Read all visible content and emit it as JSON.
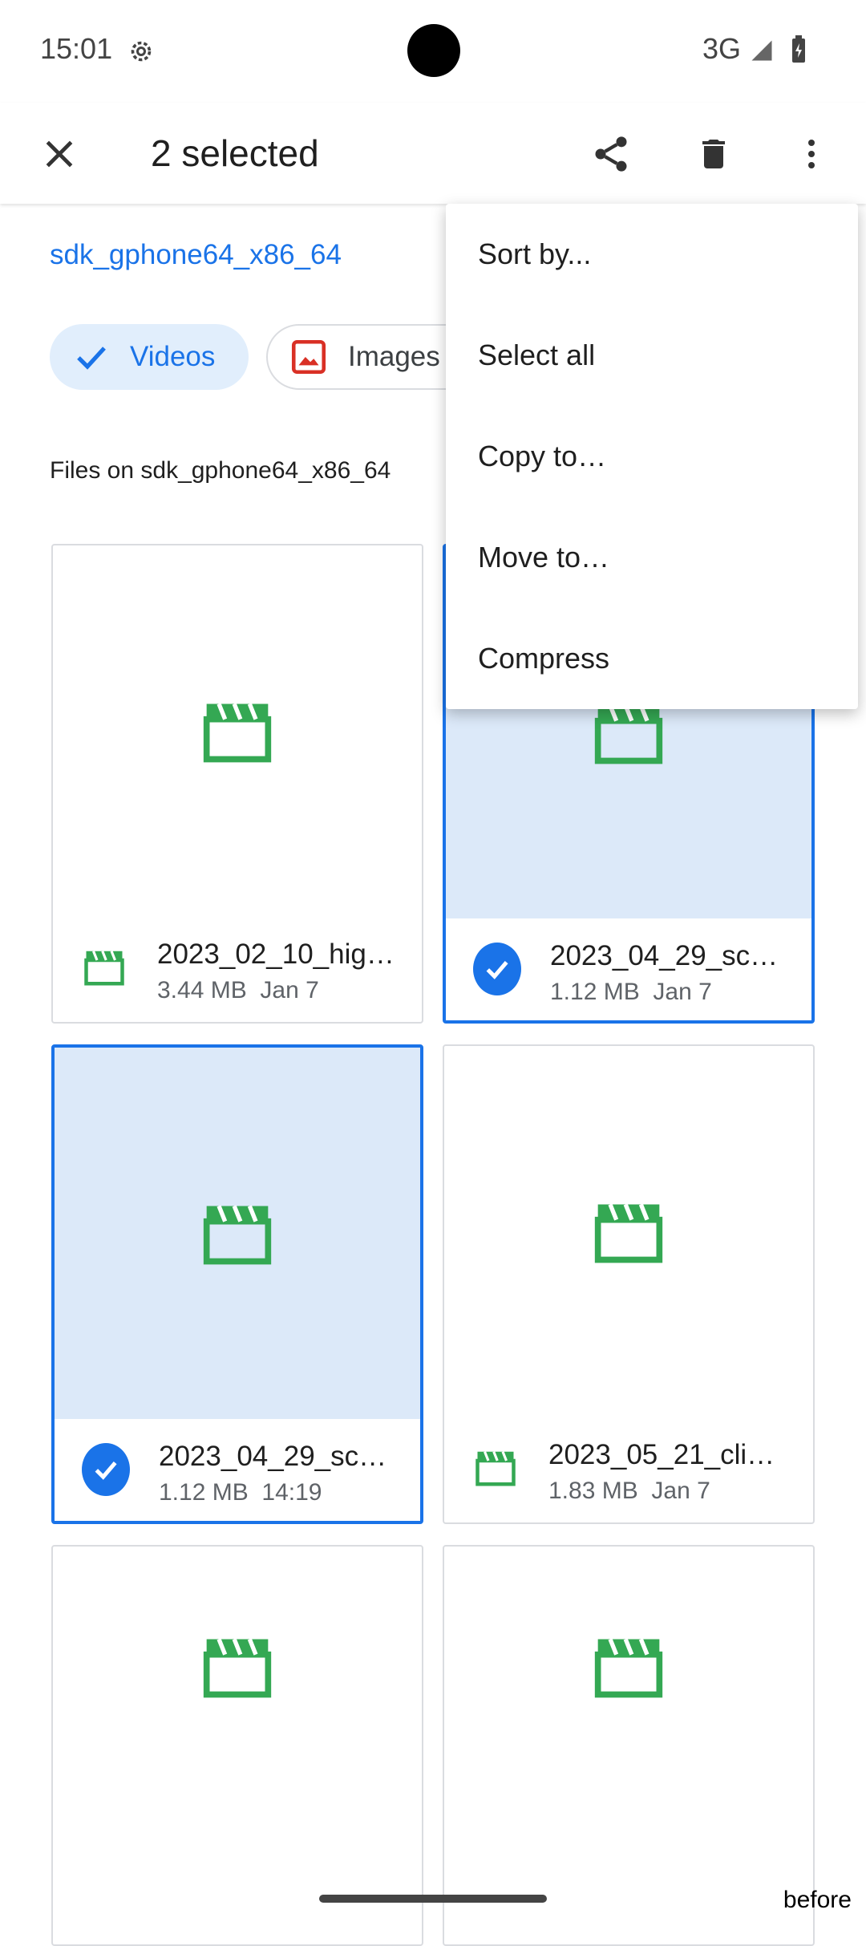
{
  "status_bar": {
    "time": "15:01",
    "network": "3G"
  },
  "app_bar": {
    "title": "2 selected"
  },
  "storage": {
    "name": "sdk_gphone64_x86_64"
  },
  "chips": [
    {
      "label": "Videos",
      "selected": true
    },
    {
      "label": "Images",
      "selected": false
    }
  ],
  "section": {
    "label": "Files on sdk_gphone64_x86_64"
  },
  "files": [
    {
      "name": "2023_02_10_hig…",
      "size": "3.44 MB",
      "date": "Jan 7",
      "selected": false
    },
    {
      "name": "2023_04_29_sc…",
      "size": "1.12 MB",
      "date": "Jan 7",
      "selected": true
    },
    {
      "name": "2023_04_29_sc…",
      "size": "1.12 MB",
      "date": "14:19",
      "selected": true
    },
    {
      "name": "2023_05_21_cli…",
      "size": "1.83 MB",
      "date": "Jan 7",
      "selected": false
    }
  ],
  "menu": {
    "items": [
      {
        "label": "Sort by..."
      },
      {
        "label": "Select all"
      },
      {
        "label": "Copy to…"
      },
      {
        "label": "Move to…"
      },
      {
        "label": "Compress"
      }
    ]
  },
  "corner_label": "before",
  "colors": {
    "accent": "#1a73e8",
    "selected_bg": "#dce9f9",
    "video_icon": "#34a853",
    "images_icon": "#d93025"
  },
  "icons": {
    "close": "close-icon",
    "share": "share-icon",
    "delete": "trash-icon",
    "more": "more-vert-icon",
    "video": "clapperboard-icon",
    "check": "check-icon",
    "image": "image-icon"
  }
}
